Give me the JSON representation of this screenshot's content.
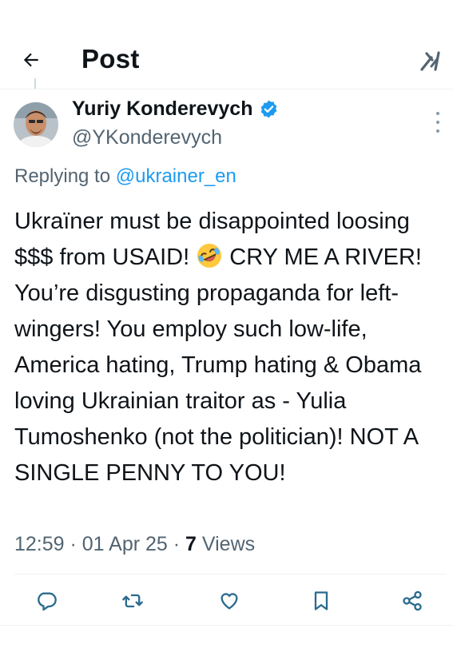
{
  "header": {
    "title": "Post",
    "back_icon": "arrow-left-icon",
    "grok_icon": "grok-icon"
  },
  "tweet": {
    "display_name": "Yuriy Konderevych",
    "handle": "@YKonderevych",
    "verified": true,
    "replying_prefix": "Replying to ",
    "replying_to": "@ukrainer_en",
    "text_before_emoji": "Ukraïner must be disappointed loosing $$$ from USAID! ",
    "emoji": "rolling-on-floor-laughing",
    "text_after_emoji": " CRY ME A RIVER! You’re disgusting propaganda for left-wingers! You employ such low-life, America hating, Trump hating & Obama loving Ukrainian traitor as - Yulia Tumoshenko (not the politician)! NOT A SINGLE PENNY TO YOU!",
    "time": "12:59",
    "date": "01 Apr 25",
    "views_count": "7",
    "views_label": "Views"
  },
  "actions": [
    {
      "name": "reply",
      "icon": "reply-icon"
    },
    {
      "name": "repost",
      "icon": "repost-icon"
    },
    {
      "name": "like",
      "icon": "heart-icon"
    },
    {
      "name": "bookmark",
      "icon": "bookmark-icon"
    },
    {
      "name": "share",
      "icon": "share-icon"
    }
  ],
  "colors": {
    "accent": "#1d9bf0",
    "text": "#0f1419",
    "secondary": "#536471",
    "icon": "#2b6b8f"
  }
}
